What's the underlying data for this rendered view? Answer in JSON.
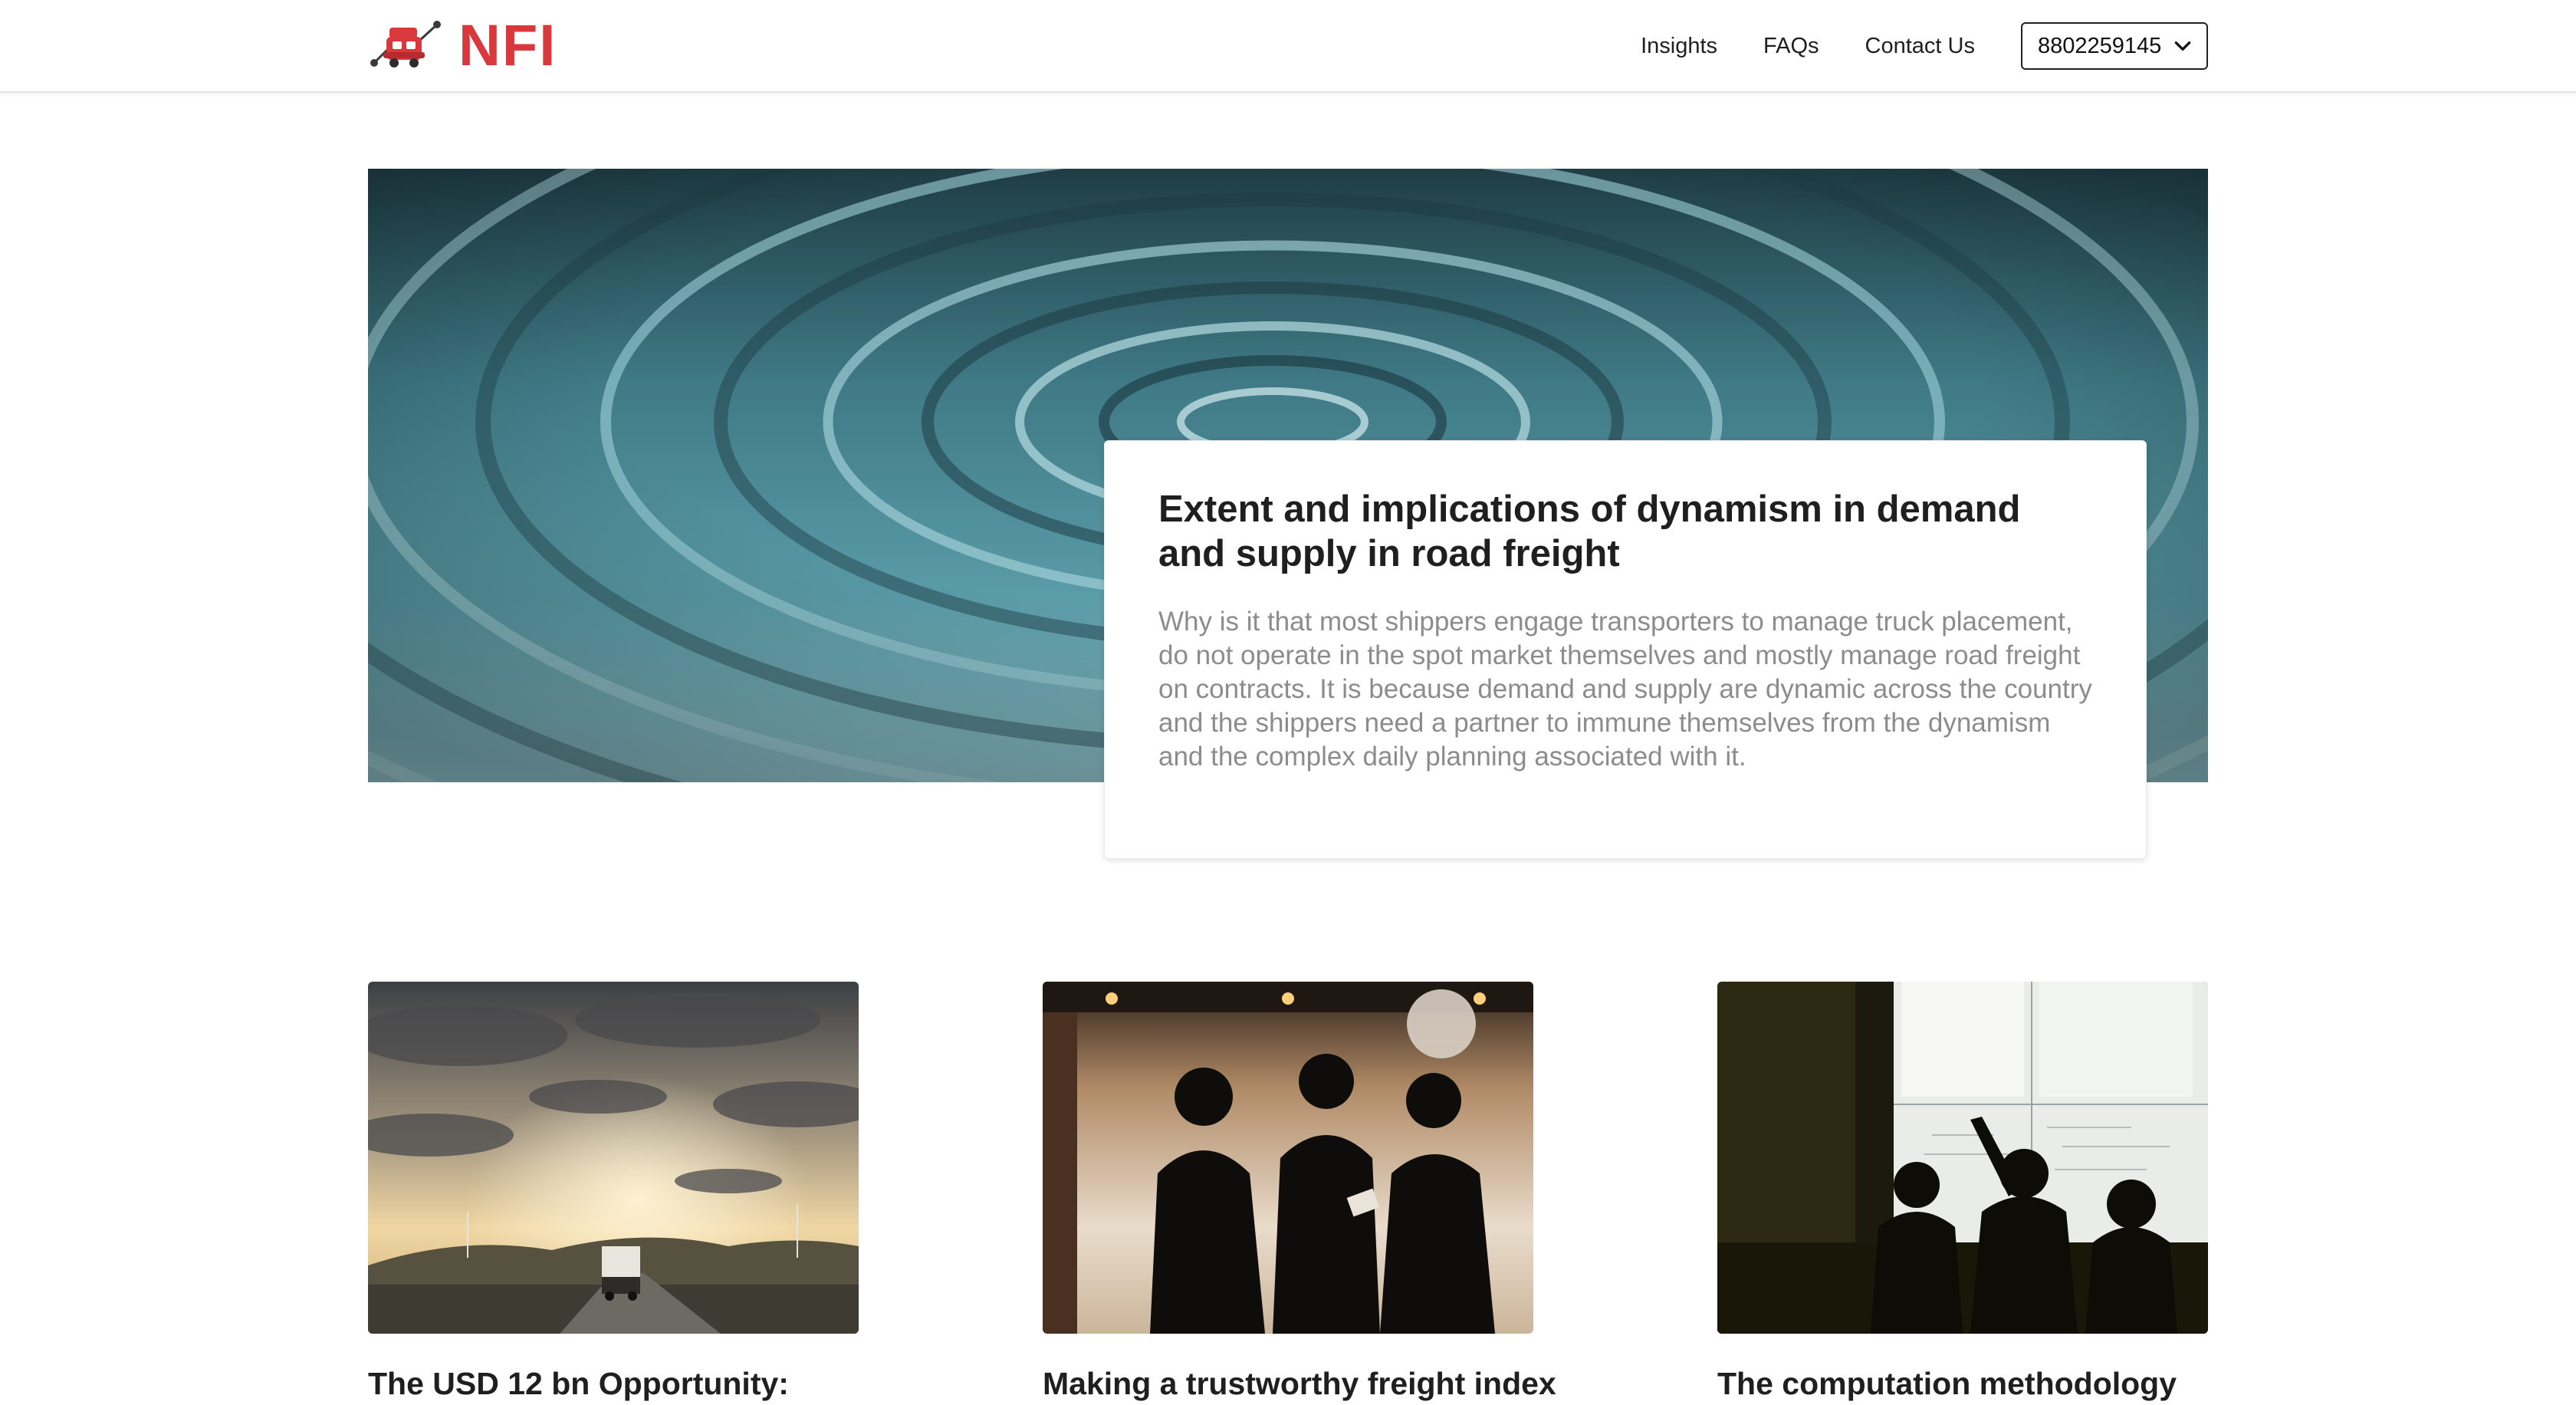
{
  "header": {
    "logo_text": "NFI",
    "nav": [
      "Insights",
      "FAQs",
      "Contact Us"
    ],
    "phone_select_value": "8802259145"
  },
  "feature": {
    "title": "Extent and implications of dynamism in demand and supply in road freight",
    "description": "Why is it that most shippers engage transporters to manage truck placement, do not operate in the spot market themselves and mostly manage road freight on contracts. It is because demand and supply are dynamic across the country and the shippers need a partner to immune themselves from the dynamism and the complex daily planning associated with it."
  },
  "cards": [
    {
      "title": "The USD 12 bn Opportunity:"
    },
    {
      "title": "Making a trustworthy freight index"
    },
    {
      "title": "The computation methodology"
    }
  ],
  "colors": {
    "brand": "#d9393c",
    "text": "#1f1f1f",
    "muted": "#8c8c8c",
    "water": "#4d8d98"
  },
  "icons": [
    "truck-network-logo-icon",
    "chevron-down-icon"
  ]
}
